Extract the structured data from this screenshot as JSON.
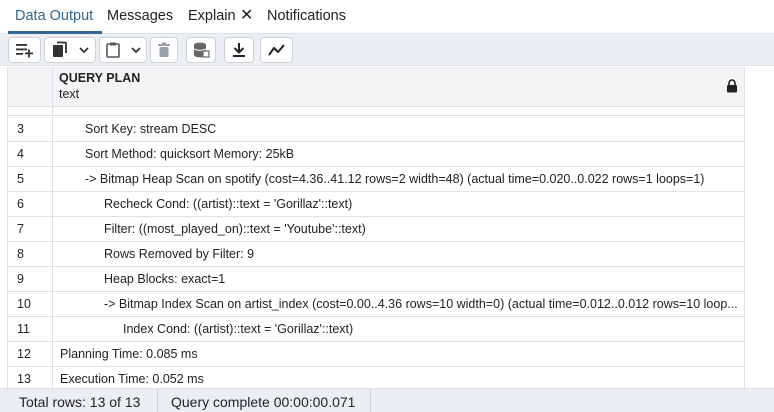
{
  "tabs": [
    {
      "label": "Data Output",
      "active": true
    },
    {
      "label": "Messages",
      "active": false
    },
    {
      "label": "Explain",
      "active": false,
      "closable": true
    },
    {
      "label": "Notifications",
      "active": false
    }
  ],
  "toolbar": {
    "buttons": [
      "add-row-icon",
      "copy-icon",
      "chevron-down-icon",
      "paste-icon",
      "chevron-down-icon",
      "trash-icon",
      "database-save-icon",
      "download-icon",
      "graph-icon"
    ]
  },
  "grid": {
    "column": {
      "name": "QUERY PLAN",
      "type": "text"
    },
    "rows": [
      {
        "num": "3",
        "text": "Sort Key: stream DESC",
        "indent": 1
      },
      {
        "num": "4",
        "text": "Sort Method: quicksort  Memory: 25kB",
        "indent": 1
      },
      {
        "num": "5",
        "text": "->  Bitmap Heap Scan on spotify  (cost=4.36..41.12 rows=2 width=48) (actual time=0.020..0.022 rows=1 loops=1)",
        "indent": 1
      },
      {
        "num": "6",
        "text": "Recheck Cond: ((artist)::text = 'Gorillaz'::text)",
        "indent": 2
      },
      {
        "num": "7",
        "text": "Filter: ((most_played_on)::text = 'Youtube'::text)",
        "indent": 2
      },
      {
        "num": "8",
        "text": "Rows Removed by Filter: 9",
        "indent": 2
      },
      {
        "num": "9",
        "text": "Heap Blocks: exact=1",
        "indent": 2
      },
      {
        "num": "10",
        "text": "->  Bitmap Index Scan on artist_index  (cost=0.00..4.36 rows=10 width=0) (actual time=0.012..0.012 rows=10 loop...",
        "indent": 2
      },
      {
        "num": "11",
        "text": "Index Cond: ((artist)::text = 'Gorillaz'::text)",
        "indent": 3
      },
      {
        "num": "12",
        "text": "Planning Time: 0.085 ms",
        "indent": 0
      },
      {
        "num": "13",
        "text": "Execution Time: 0.052 ms",
        "indent": 0
      }
    ]
  },
  "status": {
    "total_rows": "Total rows: 13 of 13",
    "query_status": "Query complete 00:00:00.071"
  },
  "colors": {
    "accent": "#326690",
    "toolbar_bg": "#ebeef3",
    "border": "#dde0e6"
  }
}
